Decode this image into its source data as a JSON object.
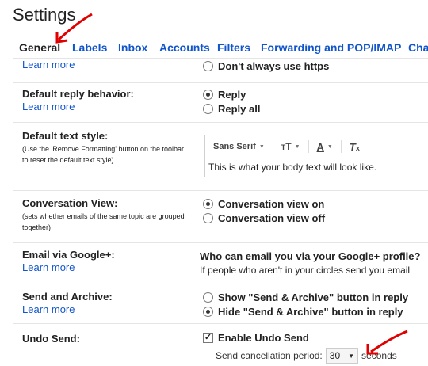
{
  "page": {
    "title": "Settings"
  },
  "tabs": [
    "General",
    "Labels",
    "Inbox",
    "Accounts",
    "Filters",
    "Forwarding and POP/IMAP",
    "Cha"
  ],
  "https": {
    "learn_more": "Learn more",
    "option_dont": "Don't always use https"
  },
  "reply": {
    "label": "Default reply behavior:",
    "learn_more": "Learn more",
    "options": [
      "Reply",
      "Reply all"
    ],
    "selected": "Reply"
  },
  "text_style": {
    "label": "Default text style:",
    "help": "(Use the 'Remove Formatting' button on the toolbar to reset the default text style)",
    "font_name": "Sans Serif",
    "preview": "This is what your body text will look like."
  },
  "conversation": {
    "label": "Conversation View:",
    "help": "(sets whether emails of the same topic are grouped together)",
    "options": [
      "Conversation view on",
      "Conversation view off"
    ],
    "selected": "Conversation view on"
  },
  "google_plus": {
    "label": "Email via Google+:",
    "learn_more": "Learn more",
    "question": "Who can email you via your Google+ profile?",
    "description": "If people who aren't in your circles send you email"
  },
  "send_archive": {
    "label": "Send and Archive:",
    "learn_more": "Learn more",
    "options": [
      "Show \"Send & Archive\" button in reply",
      "Hide \"Send & Archive\" button in reply"
    ],
    "selected": "Hide \"Send & Archive\" button in reply"
  },
  "undo_send": {
    "label": "Undo Send:",
    "checkbox_label": "Enable Undo Send",
    "checked": true,
    "period_label": "Send cancellation period:",
    "period_value": "30",
    "period_unit": "seconds"
  },
  "colors": {
    "link": "#1155cc",
    "annotation_arrow": "#e00000"
  },
  "icons": [
    "text-size-icon",
    "text-color-icon",
    "remove-formatting-icon",
    "dropdown-caret-icon",
    "checkmark-icon",
    "annotation-arrow-icon"
  ]
}
